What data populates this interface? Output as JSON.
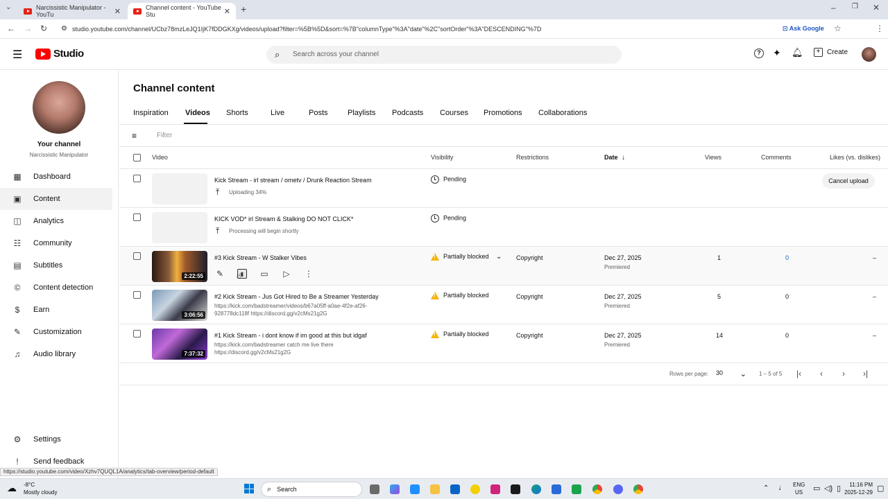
{
  "browser": {
    "tabs": [
      {
        "label": "Narcissistic Manipulator - YouTu"
      },
      {
        "label": "Channel content - YouTube Stu"
      }
    ],
    "url": "studio.youtube.com/channel/UCbz78mzLeJQ1IjK7fDDGKXg/videos/upload?filter=%5B%5D&sort=%7B\"columnType\"%3A\"date\"%2C\"sortOrder\"%3A\"DESCENDING\"%7D",
    "ask_google": "Ask Google",
    "status_url": "https://studio.youtube.com/video/Xzhv7QUQL1A/analytics/tab-overview/period-default"
  },
  "header": {
    "logo_text": "Studio",
    "search_placeholder": "Search across your channel",
    "create_label": "Create"
  },
  "sidebar": {
    "channel_title": "Your channel",
    "channel_name": "Narcissistic Manipulator",
    "items": [
      {
        "label": "Dashboard",
        "icon": "dashboard-icon"
      },
      {
        "label": "Content",
        "icon": "content-icon"
      },
      {
        "label": "Analytics",
        "icon": "analytics-icon"
      },
      {
        "label": "Community",
        "icon": "community-icon"
      },
      {
        "label": "Subtitles",
        "icon": "subtitles-icon"
      },
      {
        "label": "Content detection",
        "icon": "content-detection-icon"
      },
      {
        "label": "Earn",
        "icon": "earn-icon"
      },
      {
        "label": "Customization",
        "icon": "customization-icon"
      },
      {
        "label": "Audio library",
        "icon": "audio-library-icon"
      }
    ],
    "settings": "Settings",
    "feedback": "Send feedback"
  },
  "main": {
    "title": "Channel content",
    "tabs": [
      "Inspiration",
      "Videos",
      "Shorts",
      "Live",
      "Posts",
      "Playlists",
      "Podcasts",
      "Courses",
      "Promotions",
      "Collaborations"
    ],
    "filter_placeholder": "Filter",
    "columns": {
      "video": "Video",
      "visibility": "Visibility",
      "restrictions": "Restrictions",
      "date": "Date",
      "views": "Views",
      "comments": "Comments",
      "likes": "Likes (vs. dislikes)"
    },
    "rows": [
      {
        "title": "Kick Stream - irl stream / ometv / Drunk Reaction Stream",
        "sub": "Uploading 34%",
        "visibility": "Pending",
        "action": "Cancel upload"
      },
      {
        "title": "KICK VOD* irl Stream & Stalking DO NOT CLICK*",
        "sub": "Processing will begin shortly",
        "visibility": "Pending"
      },
      {
        "title": "#3 Kick Stream - W Stalker Vibes",
        "duration": "2:22:55",
        "visibility": "Partially blocked",
        "restrictions": "Copyright",
        "date": "Dec 27, 2025",
        "date_sub": "Premiered",
        "views": "1",
        "comments": "0",
        "likes": "–"
      },
      {
        "title": "#2 Kick Stream - Jus Got Hired to Be a Streamer Yesterday",
        "desc": "https://kick.com/badstreamer/videos/b67a05ff-a0ae-4f2e-af26-928778dc118f https://discord.gg/v2cMs21g2G",
        "duration": "3:06:56",
        "visibility": "Partially blocked",
        "restrictions": "Copyright",
        "date": "Dec 27, 2025",
        "date_sub": "Premiered",
        "views": "5",
        "comments": "0",
        "likes": "–"
      },
      {
        "title": "#1 Kick Stream - i dont know if im good at this but idgaf",
        "desc": "https://kick.com/badstreamer catch me live there https://discord.gg/v2cMs21g2G",
        "duration": "7:37:32",
        "visibility": "Partially blocked",
        "restrictions": "Copyright",
        "date": "Dec 27, 2025",
        "date_sub": "Premiered",
        "views": "14",
        "comments": "0",
        "likes": "–"
      }
    ],
    "pagination": {
      "rows_per_page_label": "Rows per page:",
      "rows_per_page": "30",
      "range": "1 – 5 of 5"
    }
  },
  "taskbar": {
    "weather_temp": "-8°C",
    "weather_desc": "Mostly cloudy",
    "search": "Search",
    "lang": "ENG",
    "region": "US",
    "time": "11:16 PM",
    "date": "2025-12-29"
  },
  "colors": {
    "accent": "#065fd4",
    "brand": "#ff0000",
    "warning": "#f6b400"
  }
}
